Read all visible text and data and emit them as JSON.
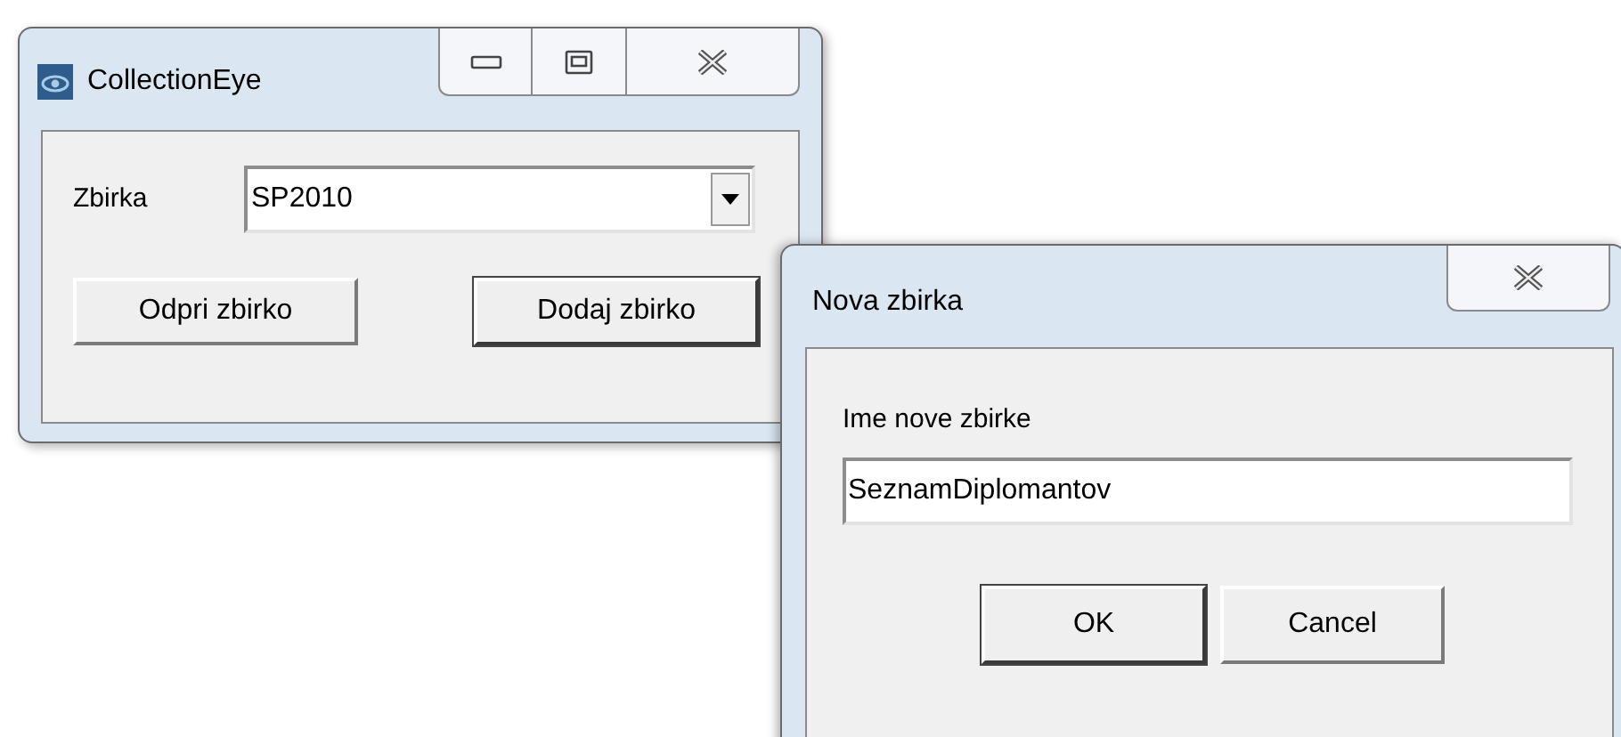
{
  "main_window": {
    "title": "CollectionEye",
    "combo": {
      "label": "Zbirka",
      "value": "SP2010"
    },
    "buttons": [
      {
        "label": "Odpri zbirko",
        "default": false
      },
      {
        "label": "Dodaj zbirko",
        "default": true
      }
    ]
  },
  "dialog": {
    "title": "Nova zbirka",
    "field": {
      "label": "Ime nove zbirke",
      "value": "SeznamDiplomantov"
    },
    "buttons": [
      {
        "label": "OK",
        "default": true
      },
      {
        "label": "Cancel",
        "default": false
      }
    ]
  }
}
